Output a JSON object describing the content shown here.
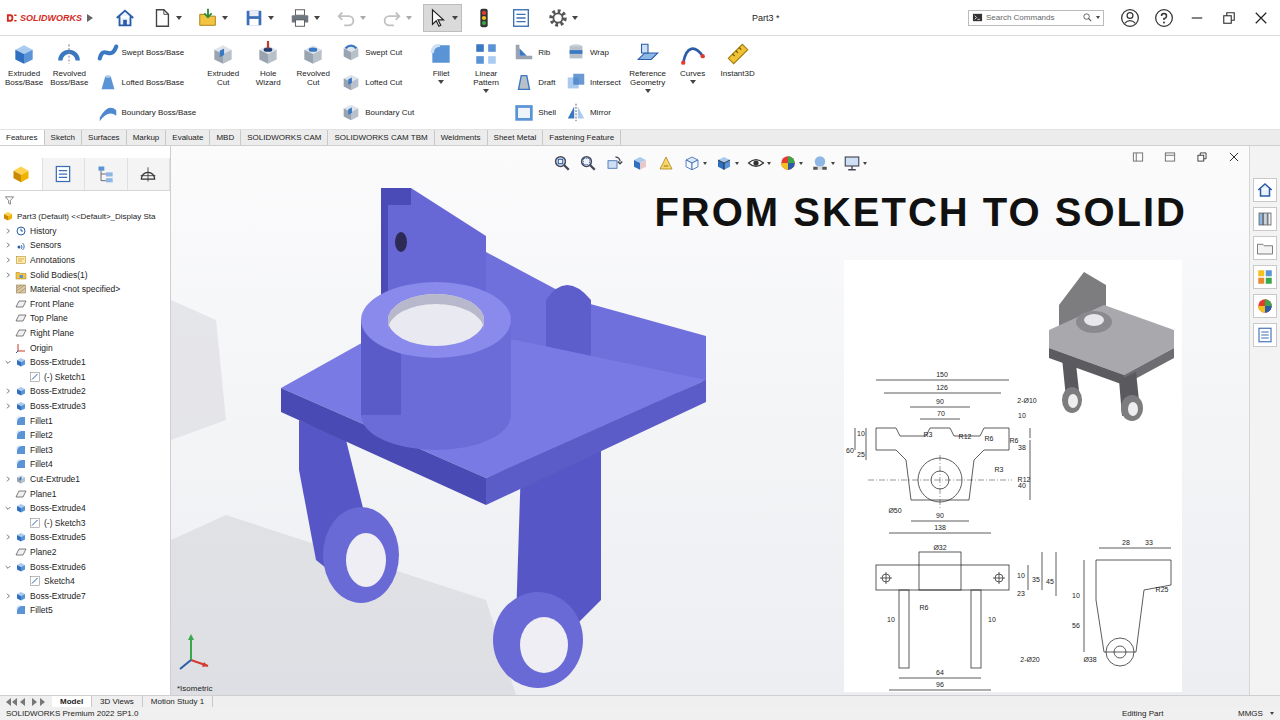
{
  "app": {
    "logo": "SOLIDWORKS",
    "title": "Part3 *"
  },
  "search": {
    "placeholder": "Search Commands"
  },
  "quick_access": [
    {
      "dropdown": false,
      "selected": false,
      "disabled": false
    },
    {
      "dropdown": true,
      "selected": false,
      "disabled": false
    },
    {
      "dropdown": true,
      "selected": false,
      "disabled": false
    },
    {
      "dropdown": true,
      "selected": false,
      "disabled": false
    },
    {
      "dropdown": true,
      "selected": false,
      "disabled": false
    },
    {
      "dropdown": true,
      "selected": false,
      "disabled": true
    },
    {
      "dropdown": true,
      "selected": false,
      "disabled": true
    },
    {
      "dropdown": true,
      "selected": true,
      "disabled": false
    },
    {
      "dropdown": false,
      "selected": false,
      "disabled": false
    },
    {
      "dropdown": false,
      "selected": false,
      "disabled": false
    },
    {
      "dropdown": true,
      "selected": false,
      "disabled": false
    }
  ],
  "ribbon": [
    {
      "kind": "large",
      "lines": [
        "Extruded",
        "Boss/Base"
      ],
      "dropdown": false
    },
    {
      "kind": "large",
      "lines": [
        "Revolved",
        "Boss/Base"
      ],
      "dropdown": false
    },
    {
      "kind": "stack",
      "items": [
        "Swept Boss/Base",
        "Lofted Boss/Base",
        "Boundary Boss/Base"
      ]
    },
    {
      "kind": "large",
      "lines": [
        "Extruded",
        "Cut"
      ],
      "dropdown": false
    },
    {
      "kind": "large",
      "lines": [
        "Hole",
        "Wizard"
      ],
      "dropdown": false
    },
    {
      "kind": "large",
      "lines": [
        "Revolved",
        "Cut"
      ],
      "dropdown": false
    },
    {
      "kind": "stack",
      "items": [
        "Swept Cut",
        "Lofted Cut",
        "Boundary Cut"
      ]
    },
    {
      "kind": "large",
      "lines": [
        "Fillet"
      ],
      "dropdown": true
    },
    {
      "kind": "large",
      "lines": [
        "Linear",
        "Pattern"
      ],
      "dropdown": true
    },
    {
      "kind": "stack",
      "items": [
        "Rib",
        "Draft",
        "Shell"
      ]
    },
    {
      "kind": "stack",
      "items": [
        "Wrap",
        "Intersect",
        "Mirror"
      ]
    },
    {
      "kind": "large",
      "lines": [
        "Reference",
        "Geometry"
      ],
      "dropdown": true
    },
    {
      "kind": "large",
      "lines": [
        "Curves"
      ],
      "dropdown": true
    },
    {
      "kind": "large",
      "lines": [
        "Instant3D"
      ],
      "dropdown": false
    }
  ],
  "command_tabs": [
    {
      "label": "Features",
      "selected": true
    },
    {
      "label": "Sketch",
      "selected": false
    },
    {
      "label": "Surfaces",
      "selected": false
    },
    {
      "label": "Markup",
      "selected": false
    },
    {
      "label": "Evaluate",
      "selected": false
    },
    {
      "label": "MBD",
      "selected": false
    },
    {
      "label": "SOLIDWORKS CAM",
      "selected": false
    },
    {
      "label": "SOLIDWORKS CAM TBM",
      "selected": false
    },
    {
      "label": "Weldments",
      "selected": false
    },
    {
      "label": "Sheet Metal",
      "selected": false
    },
    {
      "label": "Fastening Feature",
      "selected": false
    }
  ],
  "feature_tree": {
    "root": "Part3 (Default) <<Default>_Display Sta",
    "items": [
      {
        "label": "History",
        "depth": 0,
        "expandable": true,
        "expanded": false
      },
      {
        "label": "Sensors",
        "depth": 0,
        "expandable": true,
        "expanded": false
      },
      {
        "label": "Annotations",
        "depth": 0,
        "expandable": true,
        "expanded": false
      },
      {
        "label": "Solid Bodies(1)",
        "depth": 0,
        "expandable": true,
        "expanded": false
      },
      {
        "label": "Material <not specified>",
        "depth": 0,
        "expandable": false,
        "expanded": false
      },
      {
        "label": "Front Plane",
        "depth": 0,
        "expandable": false,
        "expanded": false
      },
      {
        "label": "Top Plane",
        "depth": 0,
        "expandable": false,
        "expanded": false
      },
      {
        "label": "Right Plane",
        "depth": 0,
        "expandable": false,
        "expanded": false
      },
      {
        "label": "Origin",
        "depth": 0,
        "expandable": false,
        "expanded": false
      },
      {
        "label": "Boss-Extrude1",
        "depth": 0,
        "expandable": true,
        "expanded": true
      },
      {
        "label": "(-) Sketch1",
        "depth": 1,
        "expandable": false,
        "expanded": false
      },
      {
        "label": "Boss-Extrude2",
        "depth": 0,
        "expandable": true,
        "expanded": false
      },
      {
        "label": "Boss-Extrude3",
        "depth": 0,
        "expandable": true,
        "expanded": false
      },
      {
        "label": "Fillet1",
        "depth": 0,
        "expandable": false,
        "expanded": false
      },
      {
        "label": "Fillet2",
        "depth": 0,
        "expandable": false,
        "expanded": false
      },
      {
        "label": "Fillet3",
        "depth": 0,
        "expandable": false,
        "expanded": false
      },
      {
        "label": "Fillet4",
        "depth": 0,
        "expandable": false,
        "expanded": false
      },
      {
        "label": "Cut-Extrude1",
        "depth": 0,
        "expandable": true,
        "expanded": false
      },
      {
        "label": "Plane1",
        "depth": 0,
        "expandable": false,
        "expanded": false
      },
      {
        "label": "Boss-Extrude4",
        "depth": 0,
        "expandable": true,
        "expanded": true
      },
      {
        "label": "(-) Sketch3",
        "depth": 1,
        "expandable": false,
        "expanded": false
      },
      {
        "label": "Boss-Extrude5",
        "depth": 0,
        "expandable": true,
        "expanded": false
      },
      {
        "label": "Plane2",
        "depth": 0,
        "expandable": false,
        "expanded": false
      },
      {
        "label": "Boss-Extrude6",
        "depth": 0,
        "expandable": true,
        "expanded": true
      },
      {
        "label": "Sketch4",
        "depth": 1,
        "expandable": false,
        "expanded": false
      },
      {
        "label": "Boss-Extrude7",
        "depth": 0,
        "expandable": true,
        "expanded": false
      },
      {
        "label": "Fillet5",
        "depth": 0,
        "expandable": false,
        "expanded": false
      }
    ]
  },
  "heads_up": [
    {
      "dropdown": false
    },
    {
      "dropdown": false
    },
    {
      "dropdown": false
    },
    {
      "dropdown": false
    },
    {
      "dropdown": false
    },
    {
      "dropdown": true
    },
    {
      "dropdown": true
    },
    {
      "dropdown": true
    },
    {
      "dropdown": true
    },
    {
      "dropdown": true
    },
    {
      "dropdown": true
    }
  ],
  "viewport": {
    "title": "FROM SKETCH TO SOLID",
    "view": "*Isometric"
  },
  "drawing": {
    "dims": [
      "150",
      "126",
      "90",
      "70",
      "2-Ø10",
      "R3",
      "R12",
      "R6",
      "R6",
      "R3",
      "R12",
      "10",
      "25",
      "60",
      "10",
      "38",
      "40",
      "Ø50",
      "90",
      "138",
      "Ø32",
      "10",
      "23",
      "35",
      "45",
      "R6",
      "10",
      "10",
      "64",
      "96",
      "2-Ø20",
      "28",
      "33",
      "10",
      "56",
      "R25",
      "Ø38"
    ]
  },
  "bottom_tabs": [
    {
      "label": "Model",
      "selected": true
    },
    {
      "label": "3D Views",
      "selected": false
    },
    {
      "label": "Motion Study 1",
      "selected": false
    }
  ],
  "status_bar": {
    "product": "SOLIDWORKS Premium 2022 SP1.0",
    "mode": "Editing Part",
    "units": "MMGS"
  }
}
